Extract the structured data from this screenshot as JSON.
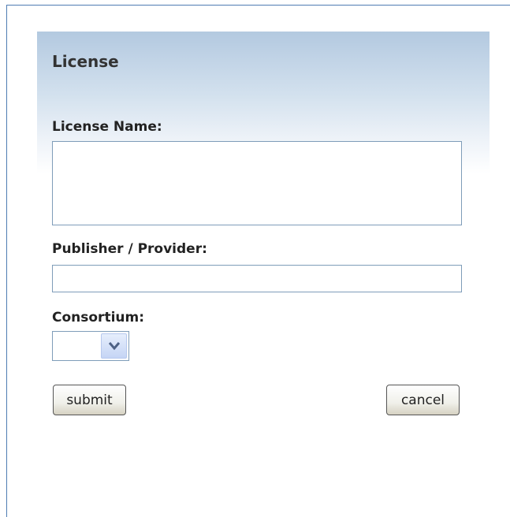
{
  "form": {
    "title": "License",
    "license_name_label": "License Name:",
    "license_name_value": "",
    "publisher_label": "Publisher / Provider:",
    "publisher_value": "",
    "consortium_label": "Consortium:",
    "consortium_selected": "",
    "submit_label": "submit",
    "cancel_label": "cancel"
  },
  "icons": {
    "dropdown": "chevron-down-icon"
  },
  "colors": {
    "frame_border": "#4f7cb3",
    "header_gradient_top": "#b3c9e0",
    "field_border": "#7f9db9",
    "text": "#222222"
  }
}
